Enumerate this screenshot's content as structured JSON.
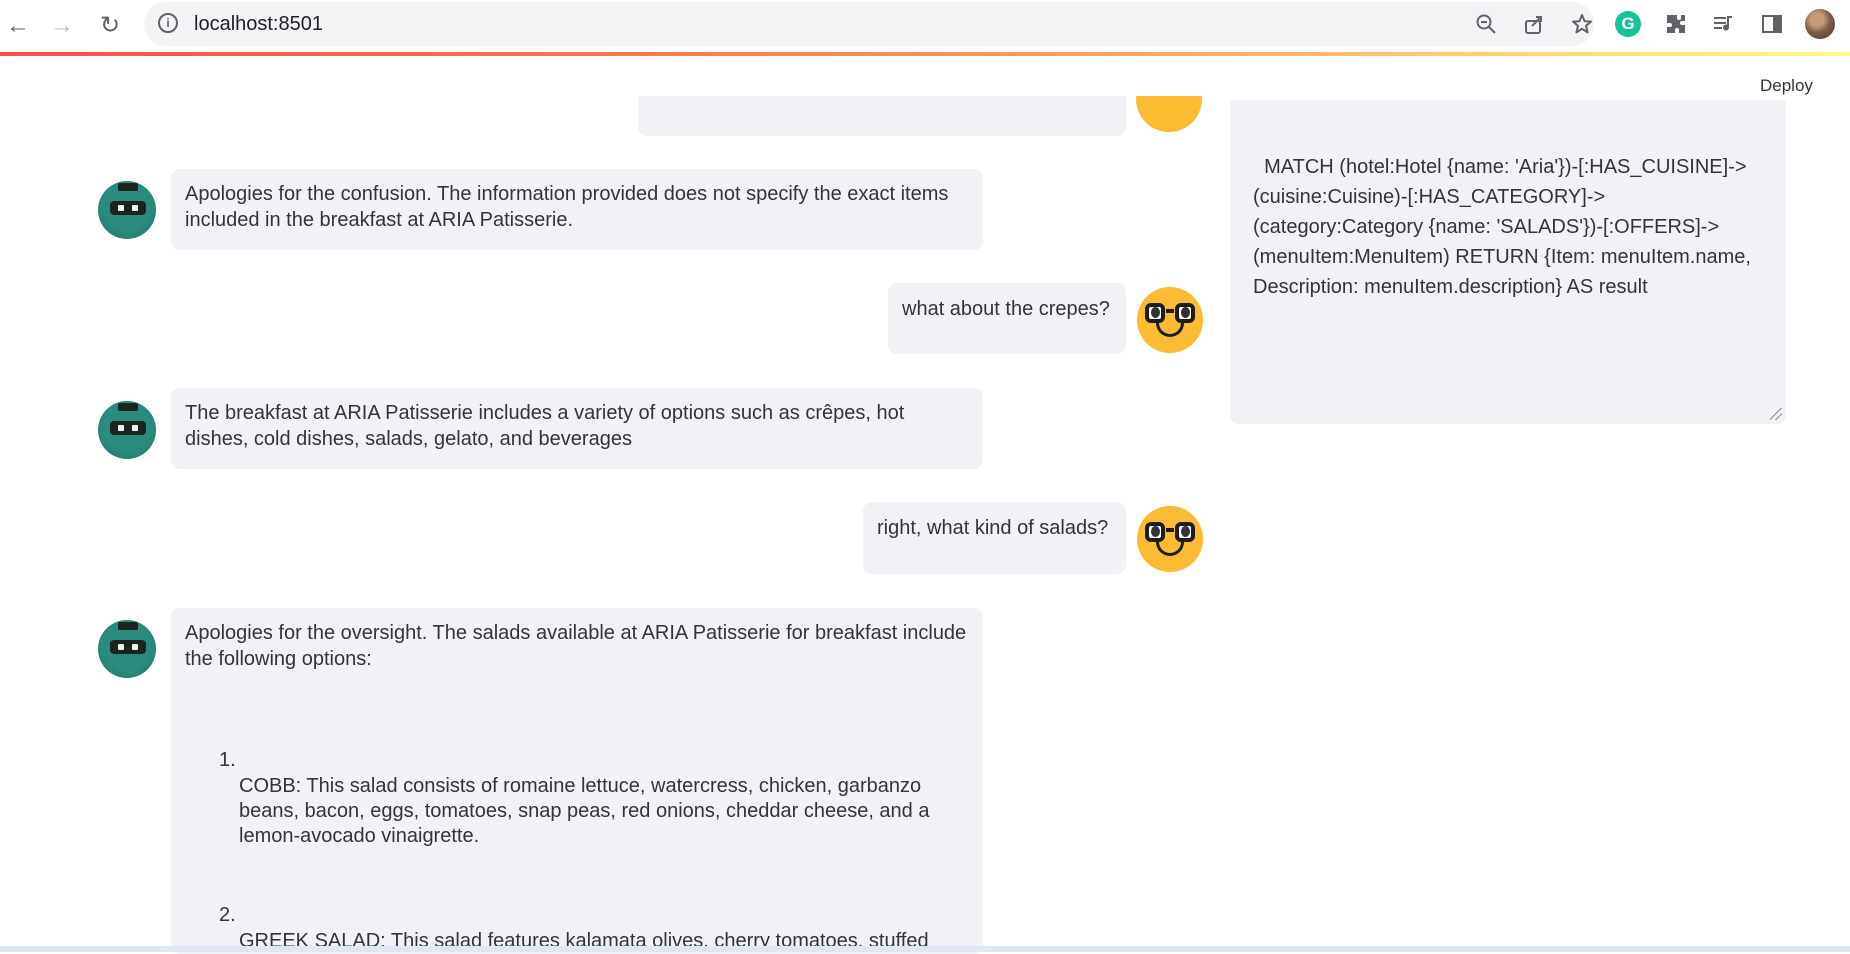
{
  "browser": {
    "url": "localhost:8501",
    "nav": {
      "back": "←",
      "forward": "→",
      "reload": "↻"
    },
    "omnibox_icons": [
      "zoom-icon",
      "share-icon",
      "star-icon"
    ],
    "extensions": [
      "grammarly-icon",
      "extensions-icon",
      "media-icon",
      "side-panel-icon",
      "profile-avatar"
    ],
    "grammarly_letter": "G"
  },
  "header": {
    "deploy_label": "Deploy"
  },
  "chat": {
    "messages": [
      {
        "role": "assistant",
        "text": "Apologies for the confusion. The information provided does not specify the exact items included in the breakfast at ARIA Patisserie."
      },
      {
        "role": "user",
        "text": "what about the crepes?"
      },
      {
        "role": "assistant",
        "text": "The breakfast at ARIA Patisserie includes a variety of options such as crêpes, hot dishes, cold dishes, salads, gelato, and beverages"
      },
      {
        "role": "user",
        "text": "right, what kind of salads?"
      },
      {
        "role": "assistant",
        "intro": "Apologies for the oversight. The salads available at ARIA Patisserie for breakfast include the following options:",
        "list": [
          {
            "num": "1.",
            "text": "COBB: This salad consists of romaine lettuce, watercress, chicken, garbanzo beans, bacon, eggs, tomatoes, snap peas, red onions, cheddar cheese, and a lemon-avocado vinaigrette."
          },
          {
            "num": "2.",
            "text": "GREEK SALAD: This salad features kalamata olives, cherry tomatoes, stuffed"
          }
        ]
      }
    ]
  },
  "query": {
    "text": "MATCH (hotel:Hotel {name: 'Aria'})-[:HAS_CUISINE]->(cuisine:Cuisine)-[:HAS_CATEGORY]->(category:Category {name: 'SALADS'})-[:OFFERS]->(menuItem:MenuItem) RETURN {Item: menuItem.name, Description: menuItem.description} AS result"
  },
  "colors": {
    "bubble": "#f0f2f6",
    "user_avatar": "#fbbc33",
    "bot_avatar": "#2b8b7f",
    "accent_bar_start": "#ff4b4b",
    "accent_bar_end": "#fffd80"
  }
}
